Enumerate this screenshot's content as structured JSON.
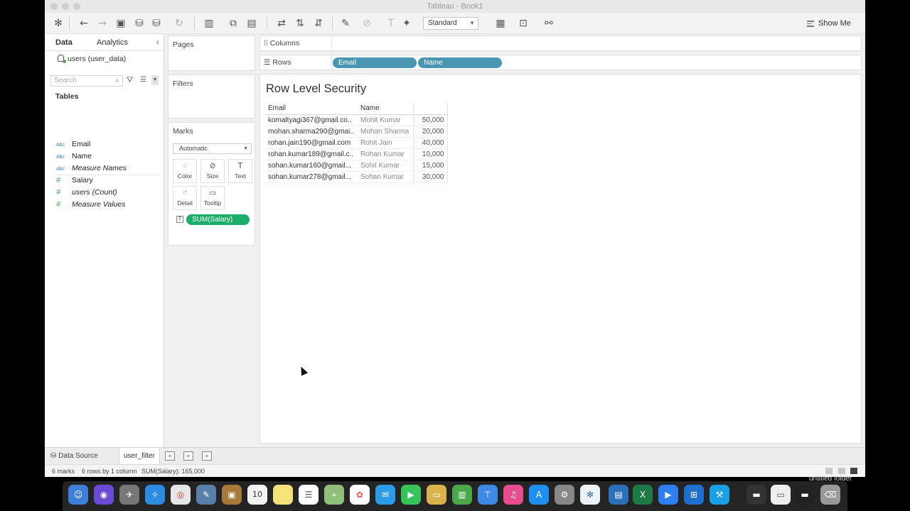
{
  "window": {
    "title": "Tableau - Book1"
  },
  "toolbar": {
    "view_mode": "Standard",
    "show_me": "Show Me"
  },
  "data_pane": {
    "tabs": [
      "Data",
      "Analytics"
    ],
    "datasource": "users (user_data)",
    "search_placeholder": "Search",
    "tables_heading": "Tables",
    "fields": [
      {
        "type": "Abc",
        "name": "Email",
        "italic": false
      },
      {
        "type": "Abc",
        "name": "Name",
        "italic": false
      },
      {
        "type": "Abc",
        "name": "Measure Names",
        "italic": true
      },
      {
        "type": "#",
        "name": "Salary",
        "italic": false
      },
      {
        "type": "#",
        "name": "users (Count)",
        "italic": true
      },
      {
        "type": "#",
        "name": "Measure Values",
        "italic": true
      }
    ]
  },
  "cards": {
    "pages": "Pages",
    "filters": "Filters",
    "marks": "Marks",
    "mark_type": "Automatic",
    "mark_buttons": [
      "Color",
      "Size",
      "Text",
      "Detail",
      "Tooltip"
    ],
    "mark_pill": "SUM(Salary)"
  },
  "shelves": {
    "columns_label": "Columns",
    "rows_label": "Rows",
    "row_pills": [
      "Email",
      "Name"
    ]
  },
  "view": {
    "title": "Row Level Security",
    "headers": {
      "email": "Email",
      "name": "Name"
    },
    "rows": [
      {
        "email": "komaltyagi367@gmail.co..",
        "name": "Mohit Kumar",
        "salary": "50,000"
      },
      {
        "email": "mohan.sharma290@gmai..",
        "name": "Mohan Sharma",
        "salary": "20,000"
      },
      {
        "email": "rohan.jain190@gmail.com",
        "name": "Rohit Jain",
        "salary": "40,000"
      },
      {
        "email": "rohan.kumar189@gmail.c..",
        "name": "Rohan Kumar",
        "salary": "10,000"
      },
      {
        "email": "sohan.kumar160@gmail...",
        "name": "Sohit Kumar",
        "salary": "15,000"
      },
      {
        "email": "sohan.kumar278@gmail...",
        "name": "Sohan Kumar",
        "salary": "30,000"
      }
    ]
  },
  "sheets": {
    "data_source": "Data Source",
    "active": "user_filter"
  },
  "status": {
    "marks": "6 marks",
    "dims": "6 rows by 1 column",
    "sum": "SUM(Salary): 165,000"
  },
  "desktop": {
    "folder_label": "untitled folder"
  }
}
